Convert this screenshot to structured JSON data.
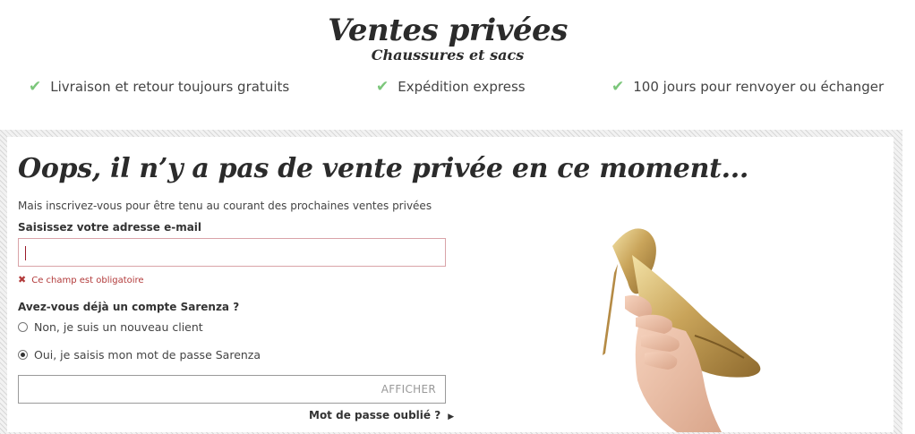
{
  "header": {
    "title": "Ventes privées",
    "subtitle": "Chaussures et sacs",
    "perks": [
      {
        "icon": "check-icon",
        "label": "Livraison et retour toujours gratuits"
      },
      {
        "icon": "check-icon",
        "label": "Expédition express"
      },
      {
        "icon": "check-icon",
        "label": "100 jours pour renvoyer ou échanger"
      }
    ]
  },
  "main": {
    "headline": "Oops, il n’y a pas de vente privée en ce moment...",
    "intro": "Mais inscrivez-vous pour être tenu au courant des prochaines ventes privées",
    "email": {
      "label": "Saisissez votre adresse e-mail",
      "value": "",
      "error": "Ce champ est obligatoire"
    },
    "account": {
      "question": "Avez-vous déjà un compte Sarenza ?",
      "options": [
        {
          "label": "Non, je suis un nouveau client",
          "checked": false
        },
        {
          "label": "Oui, je saisis mon mot de passe Sarenza",
          "checked": true
        }
      ]
    },
    "password": {
      "value": "",
      "show_label": "AFFICHER"
    },
    "forgot_label": "Mot de passe oublié ?"
  },
  "colors": {
    "check": "#7bc67a",
    "error": "#b23a3a",
    "text": "#333333"
  }
}
